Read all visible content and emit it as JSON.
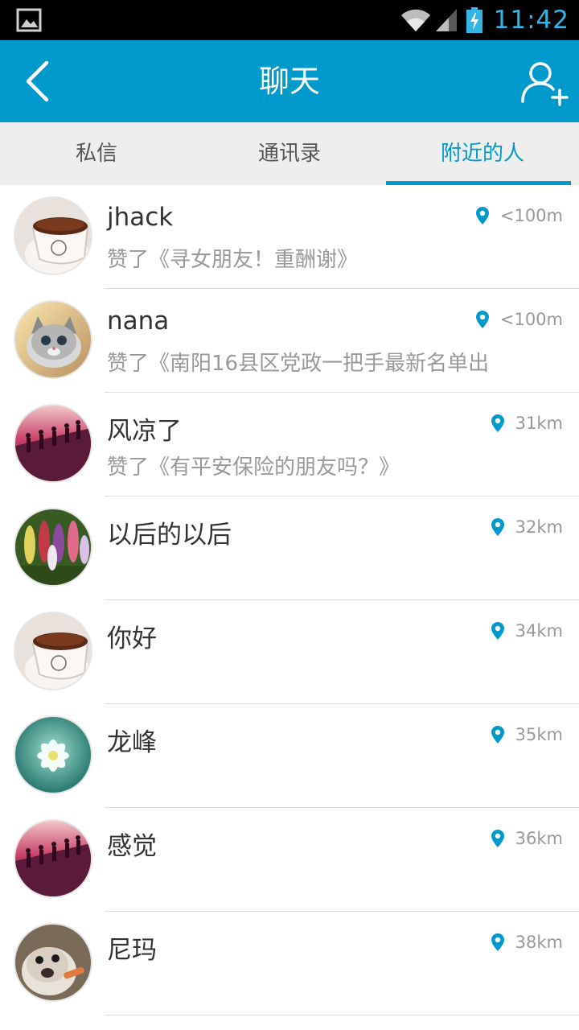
{
  "status_bar": {
    "time": "11:42",
    "icons": [
      "gallery-icon",
      "wifi-icon",
      "signal-icon",
      "battery-charging-icon"
    ],
    "time_color": "#33b5e5"
  },
  "header": {
    "title": "聊天",
    "back_icon": "back-arrow-icon",
    "add_icon": "add-friend-icon",
    "background": "#0099cc"
  },
  "tabs": [
    {
      "label": "私信",
      "active": false
    },
    {
      "label": "通讯录",
      "active": false
    },
    {
      "label": "附近的人",
      "active": true
    }
  ],
  "people": [
    {
      "name": "jhack",
      "subtitle": "赞了《寻女朋友！重酬谢》",
      "distance": "<100m",
      "avatar": "coffee-cup"
    },
    {
      "name": "nana",
      "subtitle": "赞了《南阳16县区党政一把手最新名单出",
      "distance": "<100m",
      "avatar": "cat"
    },
    {
      "name": "风凉了",
      "subtitle": "赞了《有平安保险的朋友吗？》",
      "distance": "31km",
      "avatar": "silhouettes"
    },
    {
      "name": "以后的以后",
      "subtitle": "",
      "distance": "32km",
      "avatar": "flowers"
    },
    {
      "name": "你好",
      "subtitle": "",
      "distance": "34km",
      "avatar": "coffee-cup"
    },
    {
      "name": "龙峰",
      "subtitle": "",
      "distance": "35km",
      "avatar": "lotus"
    },
    {
      "name": "感觉",
      "subtitle": "",
      "distance": "36km",
      "avatar": "silhouettes"
    },
    {
      "name": "尼玛",
      "subtitle": "",
      "distance": "38km",
      "avatar": "dog"
    }
  ],
  "colors": {
    "accent": "#0099cc",
    "tab_bar": "#eeeeee",
    "name_text": "#333333",
    "secondary_text": "#999999"
  }
}
